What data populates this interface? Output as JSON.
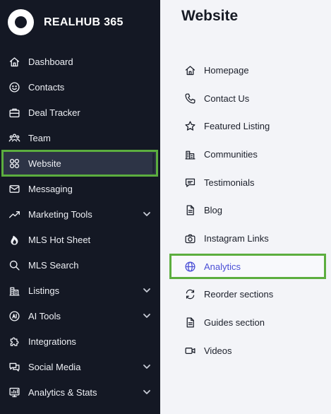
{
  "brand": {
    "name": "REALHUB 365"
  },
  "sidebar": {
    "items": [
      {
        "label": "Dashboard",
        "icon": "home-icon",
        "expandable": false
      },
      {
        "label": "Contacts",
        "icon": "smiley-icon",
        "expandable": false
      },
      {
        "label": "Deal Tracker",
        "icon": "briefcase-icon",
        "expandable": false
      },
      {
        "label": "Team",
        "icon": "team-icon",
        "expandable": false
      },
      {
        "label": "Website",
        "icon": "grid-circles-icon",
        "expandable": false,
        "active": true
      },
      {
        "label": "Messaging",
        "icon": "mail-icon",
        "expandable": false
      },
      {
        "label": "Marketing Tools",
        "icon": "trend-icon",
        "expandable": true
      },
      {
        "label": "MLS Hot Sheet",
        "icon": "flame-icon",
        "expandable": false
      },
      {
        "label": "MLS Search",
        "icon": "search-icon",
        "expandable": false
      },
      {
        "label": "Listings",
        "icon": "buildings-icon",
        "expandable": true
      },
      {
        "label": "AI Tools",
        "icon": "ai-icon",
        "expandable": true
      },
      {
        "label": "Integrations",
        "icon": "puzzle-icon",
        "expandable": false
      },
      {
        "label": "Social Media",
        "icon": "chat-bubbles-icon",
        "expandable": true
      },
      {
        "label": "Analytics & Stats",
        "icon": "monitor-chart-icon",
        "expandable": true
      }
    ]
  },
  "main": {
    "title": "Website",
    "items": [
      {
        "label": "Homepage",
        "icon": "home-icon"
      },
      {
        "label": "Contact Us",
        "icon": "phone-icon"
      },
      {
        "label": "Featured Listing",
        "icon": "star-icon"
      },
      {
        "label": "Communities",
        "icon": "buildings-icon"
      },
      {
        "label": "Testimonials",
        "icon": "message-icon"
      },
      {
        "label": "Blog",
        "icon": "document-icon"
      },
      {
        "label": "Instagram Links",
        "icon": "camera-icon"
      },
      {
        "label": "Analytics",
        "icon": "globe-icon",
        "active": true
      },
      {
        "label": "Reorder sections",
        "icon": "reorder-icon"
      },
      {
        "label": "Guides section",
        "icon": "document-icon"
      },
      {
        "label": "Videos",
        "icon": "video-icon"
      }
    ]
  },
  "colors": {
    "sidebar_bg": "#141824",
    "active_outline": "#5cae3f",
    "active_text": "#4a4fd6",
    "main_bg": "#f3f4f8"
  }
}
